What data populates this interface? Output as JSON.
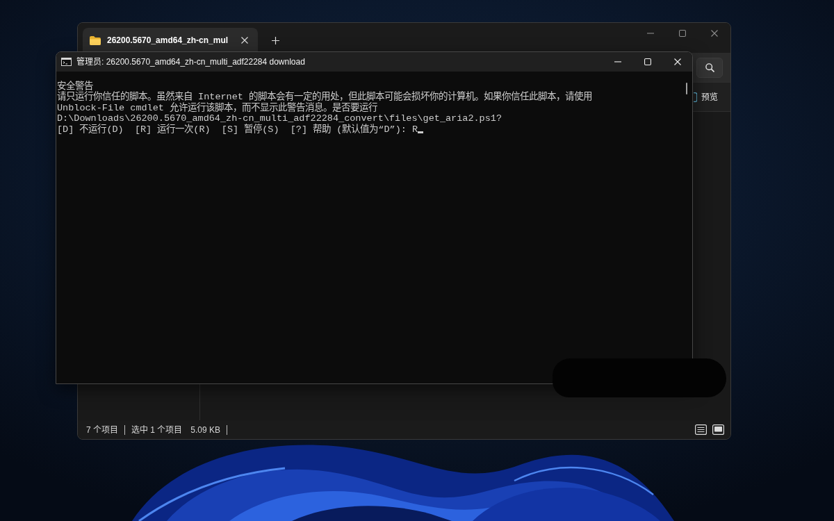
{
  "explorer": {
    "tabs": [
      {
        "label": "26200.5670_amd64_zh-cn_mul",
        "selected": true
      }
    ],
    "command_bar": {
      "preview_button": "预览"
    },
    "status_bar": {
      "item_count": "7 个项目",
      "selection": "选中 1 个项目",
      "size": "5.09 KB"
    }
  },
  "console": {
    "title": "管理员: 26200.5670_amd64_zh-cn_multi_adf22284 download",
    "lines": [
      "安全警告",
      "请只运行你信任的脚本。虽然来自 Internet 的脚本会有一定的用处，但此脚本可能会损坏你的计算机。如果你信任此脚本，请使用",
      "Unblock-File cmdlet 允许运行该脚本，而不显示此警告消息。是否要运行",
      "D:\\Downloads\\26200.5670_amd64_zh-cn_multi_adf22284_convert\\files\\get_aria2.ps1?",
      "[D] 不运行(D)  [R] 运行一次(R)  [S] 暂停(S)  [?] 帮助 (默认值为“D”): R"
    ],
    "cursor": true
  }
}
